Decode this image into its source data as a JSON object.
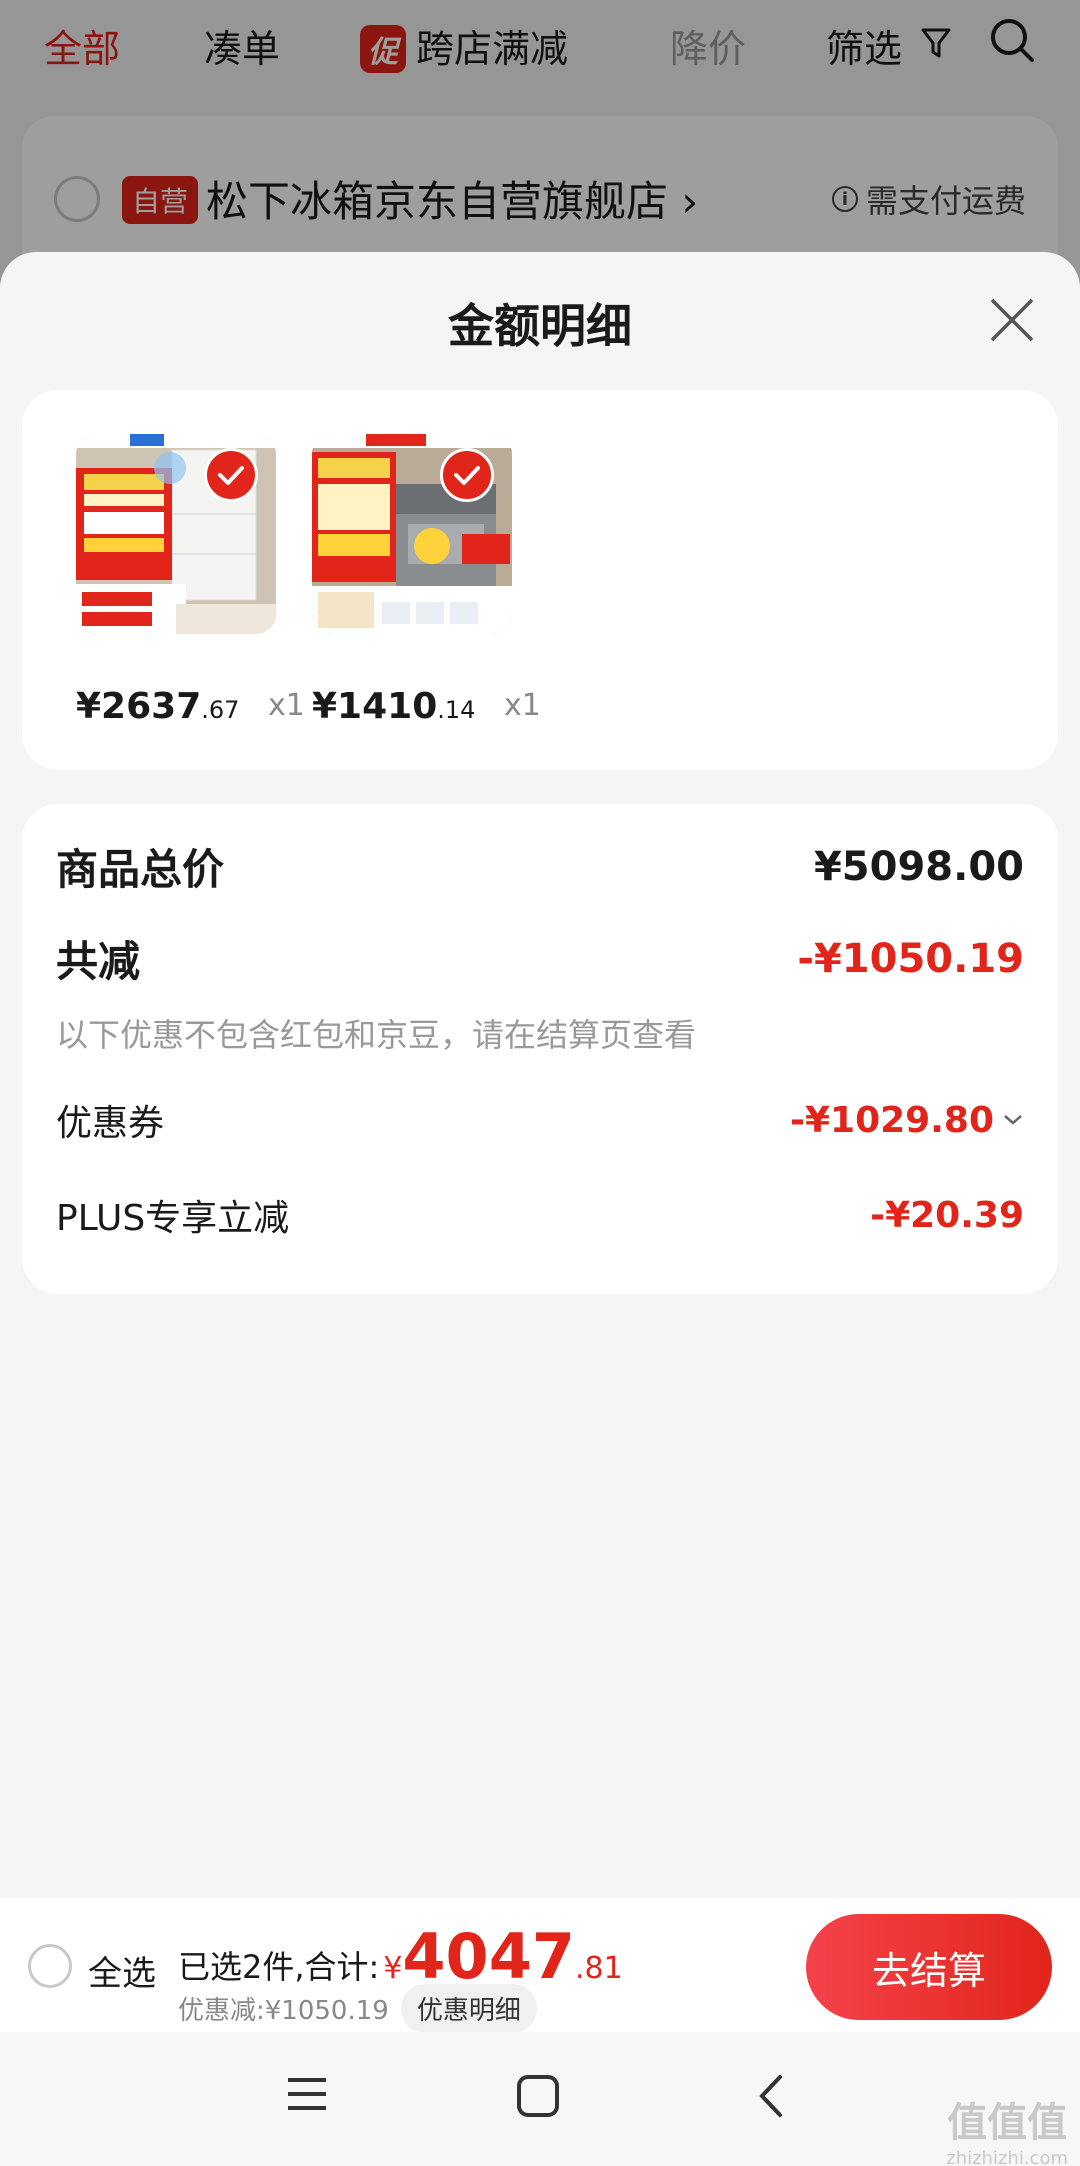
{
  "background": {
    "filters": [
      {
        "label": "全部",
        "active": true
      },
      {
        "label": "凑单"
      },
      {
        "label": "跨店满减",
        "badge": "促"
      },
      {
        "label": "降价"
      },
      {
        "label": "筛选"
      }
    ],
    "store": {
      "badge": "自营",
      "name": "松下冰箱京东自营旗舰店 ›",
      "shipping_note": "需支付运费"
    }
  },
  "sheet": {
    "title": "金额明细",
    "products": [
      {
        "price_int": "¥2637",
        "price_dec": ".67",
        "qty": "x1"
      },
      {
        "price_int": "¥1410",
        "price_dec": ".14",
        "qty": "x1"
      }
    ],
    "summary": {
      "total_label": "商品总价",
      "total_value": "¥5098.00",
      "reduce_label": "共减",
      "reduce_value": "-¥1050.19",
      "reduce_note": "以下优惠不包含红包和京豆，请在结算页查看",
      "coupon_label": "优惠券",
      "coupon_value": "-¥1029.80",
      "plus_label": "PLUS专享立减",
      "plus_value": "-¥20.39"
    }
  },
  "bottom_bar": {
    "select_all": "全选",
    "selected_text": "已选2件,合计:",
    "currency": "¥",
    "total_int": "4047",
    "total_dec": ".81",
    "discount_text": "优惠减:¥1050.19",
    "detail_chip": "优惠明细",
    "checkout": "去结算"
  },
  "watermark": {
    "text": "值值值",
    "url": "zhizhizhi.com"
  },
  "colors": {
    "accent": "#e1251b"
  }
}
